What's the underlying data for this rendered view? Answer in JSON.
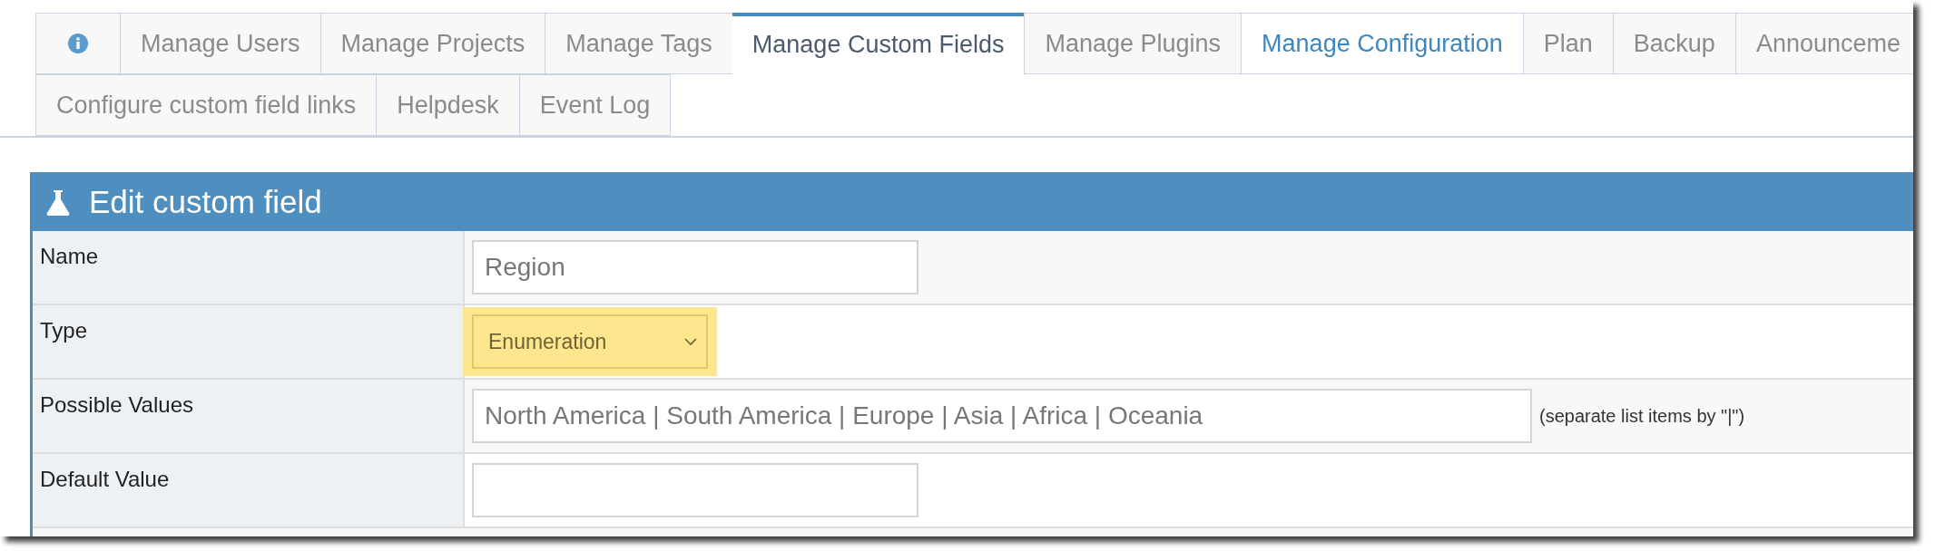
{
  "tabs": [
    [
      {
        "kind": "info",
        "selected": false,
        "highlighted": false
      },
      {
        "label": "Manage Users",
        "kind": "text",
        "selected": false,
        "highlighted": false
      },
      {
        "label": "Manage Projects",
        "kind": "text",
        "selected": false,
        "highlighted": false
      },
      {
        "label": "Manage Tags",
        "kind": "text",
        "selected": false,
        "highlighted": false
      },
      {
        "label": "Manage Custom Fields",
        "kind": "text",
        "selected": true,
        "highlighted": false
      },
      {
        "label": "Manage Plugins",
        "kind": "text",
        "selected": false,
        "highlighted": false
      },
      {
        "label": "Manage Configuration",
        "kind": "text",
        "selected": false,
        "highlighted": true
      },
      {
        "label": "Plan",
        "kind": "text",
        "selected": false,
        "highlighted": false
      },
      {
        "label": "Backup",
        "kind": "text",
        "selected": false,
        "highlighted": false
      },
      {
        "label": "Announceme",
        "kind": "text",
        "selected": false,
        "highlighted": false
      }
    ],
    [
      {
        "label": "Configure custom field links",
        "kind": "text",
        "selected": false,
        "highlighted": false
      },
      {
        "label": "Helpdesk",
        "kind": "text",
        "selected": false,
        "highlighted": false
      },
      {
        "label": "Event Log",
        "kind": "text",
        "selected": false,
        "highlighted": false
      }
    ]
  ],
  "panel": {
    "title": "Edit custom field",
    "rows": [
      {
        "label": "Name",
        "kind": "text",
        "value": "Region",
        "wide": false
      },
      {
        "label": "Type",
        "kind": "select",
        "value": "Enumeration",
        "highlighted": true
      },
      {
        "label": "Possible Values",
        "kind": "text",
        "value": "North America | South America | Europe | Asia | Africa | Oceania",
        "wide": true,
        "hint": "(separate list items by \"|\")"
      },
      {
        "label": "Default Value",
        "kind": "text",
        "value": "",
        "wide": false
      }
    ]
  }
}
